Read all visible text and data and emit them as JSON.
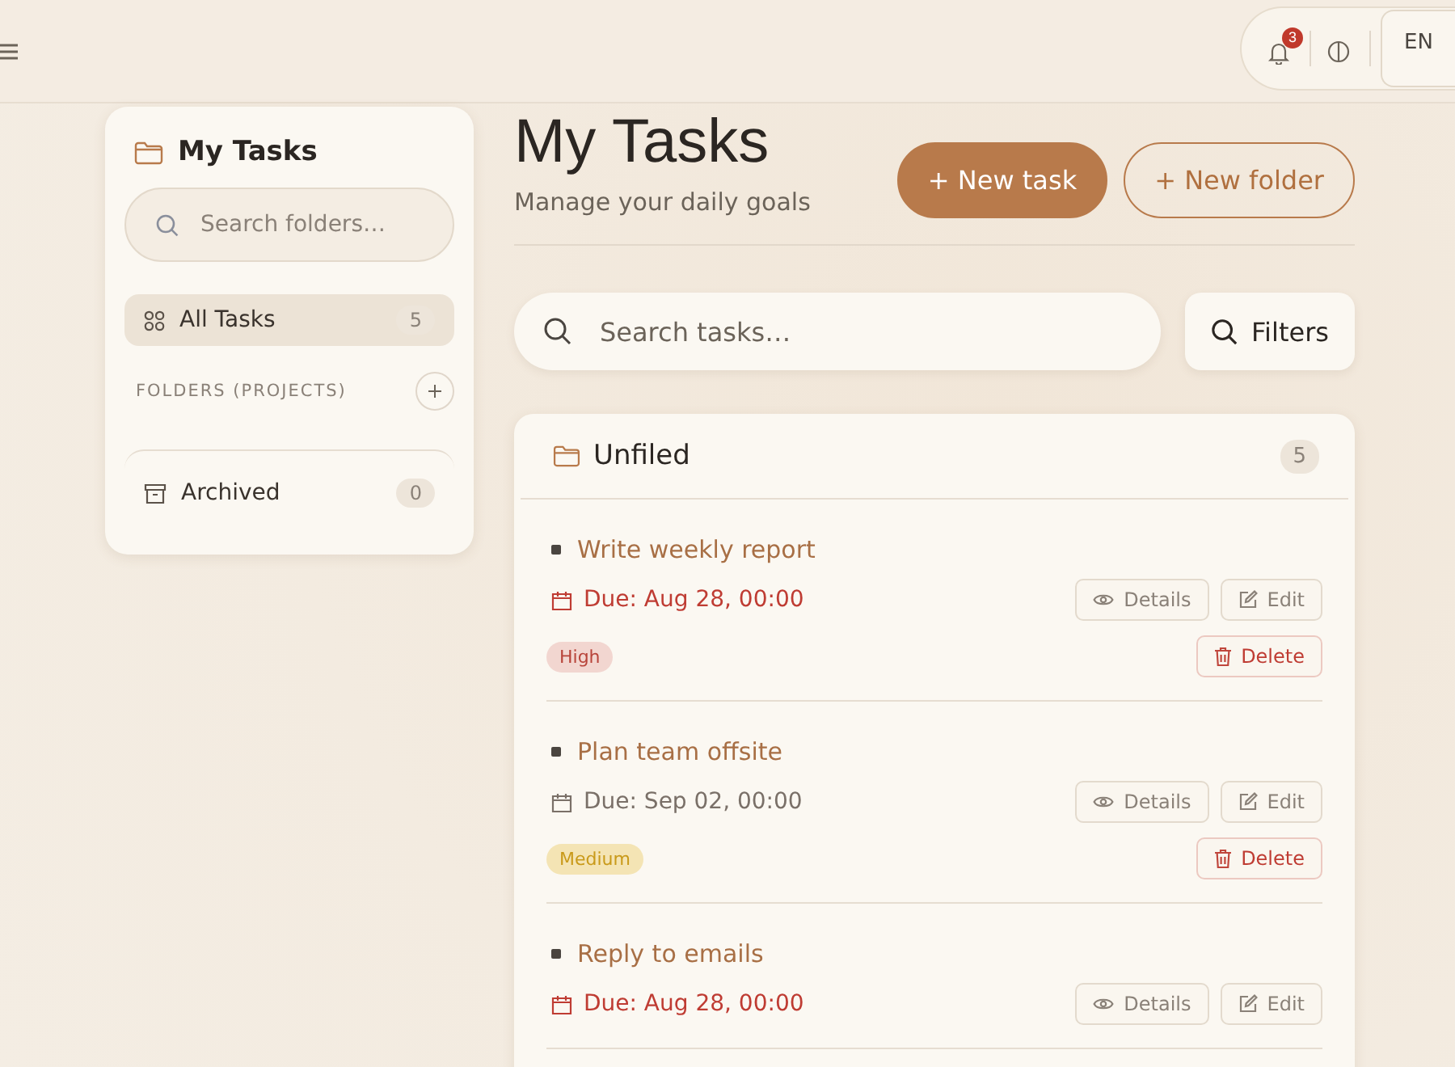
{
  "header": {
    "notifications": "3",
    "language": "EN"
  },
  "sidebar": {
    "title": "My Tasks",
    "search": {
      "placeholder": "Search folders…"
    },
    "items": [
      {
        "kind": "all",
        "label": "All Tasks",
        "count": "5",
        "selected": true
      }
    ],
    "folders_heading": "FOLDERS (PROJECTS)",
    "archived": {
      "label": "Archived",
      "count": "0",
      "selected": false
    }
  },
  "page": {
    "title": "My Tasks",
    "subtitle": "Manage your daily goals",
    "buttons": [
      {
        "kind": "primary",
        "label": "+ New task"
      },
      {
        "kind": "outline",
        "label": "+ New folder"
      }
    ]
  },
  "search": {
    "placeholder": "Search tasks…",
    "filters": "Filters"
  },
  "group": {
    "name": "Unfiled",
    "count": "5",
    "tasks": [
      {
        "title": "Write weekly report",
        "due": "Due: Aug 28, 00:00",
        "overdue": true,
        "priority": {
          "kind": "high",
          "label": "High"
        },
        "actions": [
          "Details",
          "Edit",
          "Delete"
        ]
      },
      {
        "title": "Plan team offsite",
        "due": "Due: Sep 02, 00:00",
        "overdue": false,
        "priority": {
          "kind": "medium",
          "label": "Medium"
        },
        "actions": [
          "Details",
          "Edit",
          "Delete"
        ]
      },
      {
        "title": "Reply to emails",
        "due": "Due: Aug 28, 00:00",
        "overdue": true,
        "actions": [
          "Details",
          "Edit"
        ]
      }
    ]
  }
}
